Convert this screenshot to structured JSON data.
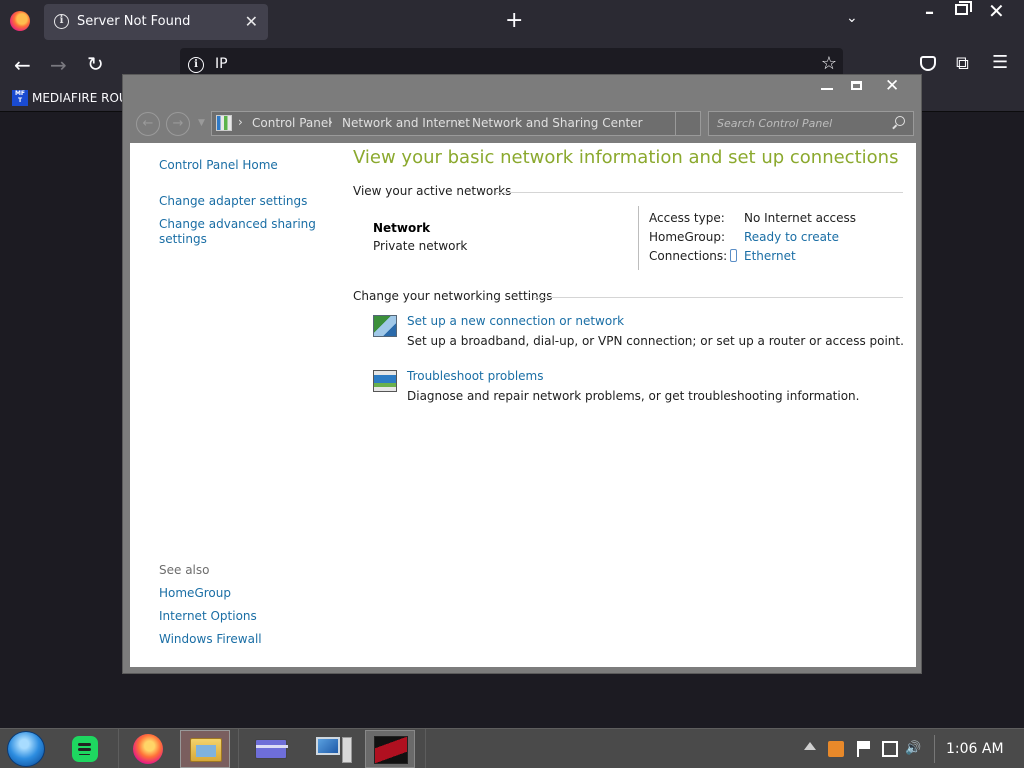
{
  "browser": {
    "tab_title": "Server Not Found",
    "url": "IP",
    "bookmark_label": "MEDIAFIRE ROUL",
    "bookmark_favicon_text": "MF T"
  },
  "control_panel": {
    "breadcrumbs": [
      "Control Panel",
      "Network and Internet",
      "Network and Sharing Center"
    ],
    "search_placeholder": "Search Control Panel",
    "sidebar": {
      "home": "Control Panel Home",
      "links": [
        "Change adapter settings",
        "Change advanced sharing settings"
      ],
      "see_also_label": "See also",
      "see_also": [
        "HomeGroup",
        "Internet Options",
        "Windows Firewall"
      ]
    },
    "main": {
      "title": "View your basic network information and set up connections",
      "active_networks_heading": "View your active networks",
      "network_name": "Network",
      "network_type": "Private network",
      "access_type_label": "Access type:",
      "access_type_value": "No Internet access",
      "homegroup_label": "HomeGroup:",
      "homegroup_value": "Ready to create",
      "connections_label": "Connections:",
      "connections_value": "Ethernet",
      "change_settings_heading": "Change your networking settings",
      "tasks": [
        {
          "link": "Set up a new connection or network",
          "description": "Set up a broadband, dial-up, or VPN connection; or set up a router or access point."
        },
        {
          "link": "Troubleshoot problems",
          "description": "Diagnose and repair network problems, or get troubleshooting information."
        }
      ]
    }
  },
  "taskbar": {
    "clock": "1:06 AM"
  },
  "colors": {
    "link": "#1a6ea5",
    "title_green": "#8ba92e",
    "browser_chrome": "#2b2a33"
  }
}
